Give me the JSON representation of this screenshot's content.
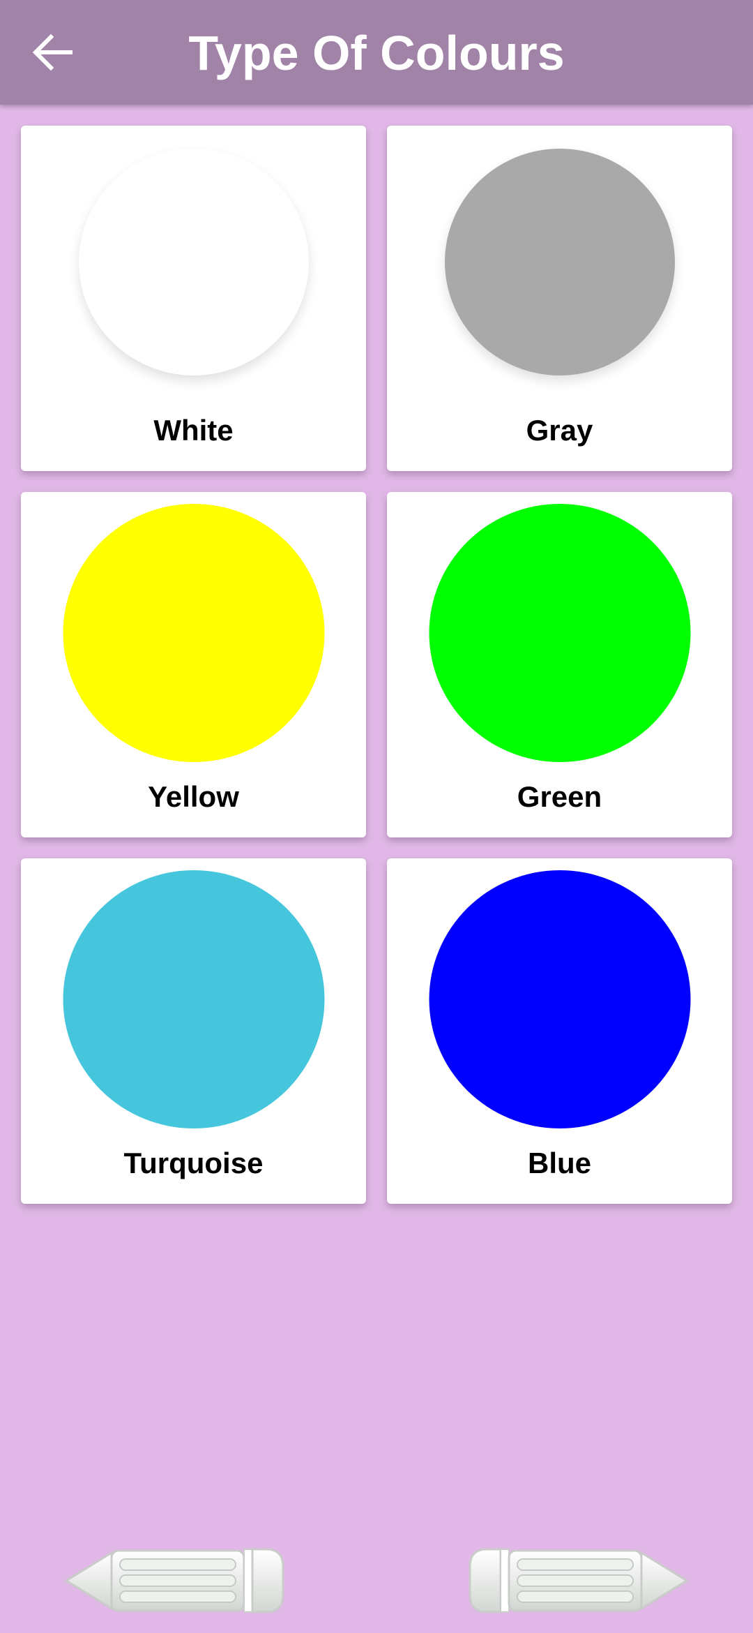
{
  "header": {
    "title": "Type Of Colours",
    "back_icon": "arrow-left-icon"
  },
  "colors": [
    {
      "name": "White",
      "hex": "#ffffff"
    },
    {
      "name": "Gray",
      "hex": "#a9a9a9"
    },
    {
      "name": "Yellow",
      "hex": "#ffff00"
    },
    {
      "name": "Green",
      "hex": "#00ff00"
    },
    {
      "name": "Turquoise",
      "hex": "#46c6dc"
    },
    {
      "name": "Blue",
      "hex": "#0000ff"
    }
  ],
  "theme": {
    "background": "#e1b7e7",
    "appbar": "#a083a6"
  },
  "navigation": {
    "prev_icon": "pencil-left-icon",
    "next_icon": "pencil-right-icon"
  }
}
